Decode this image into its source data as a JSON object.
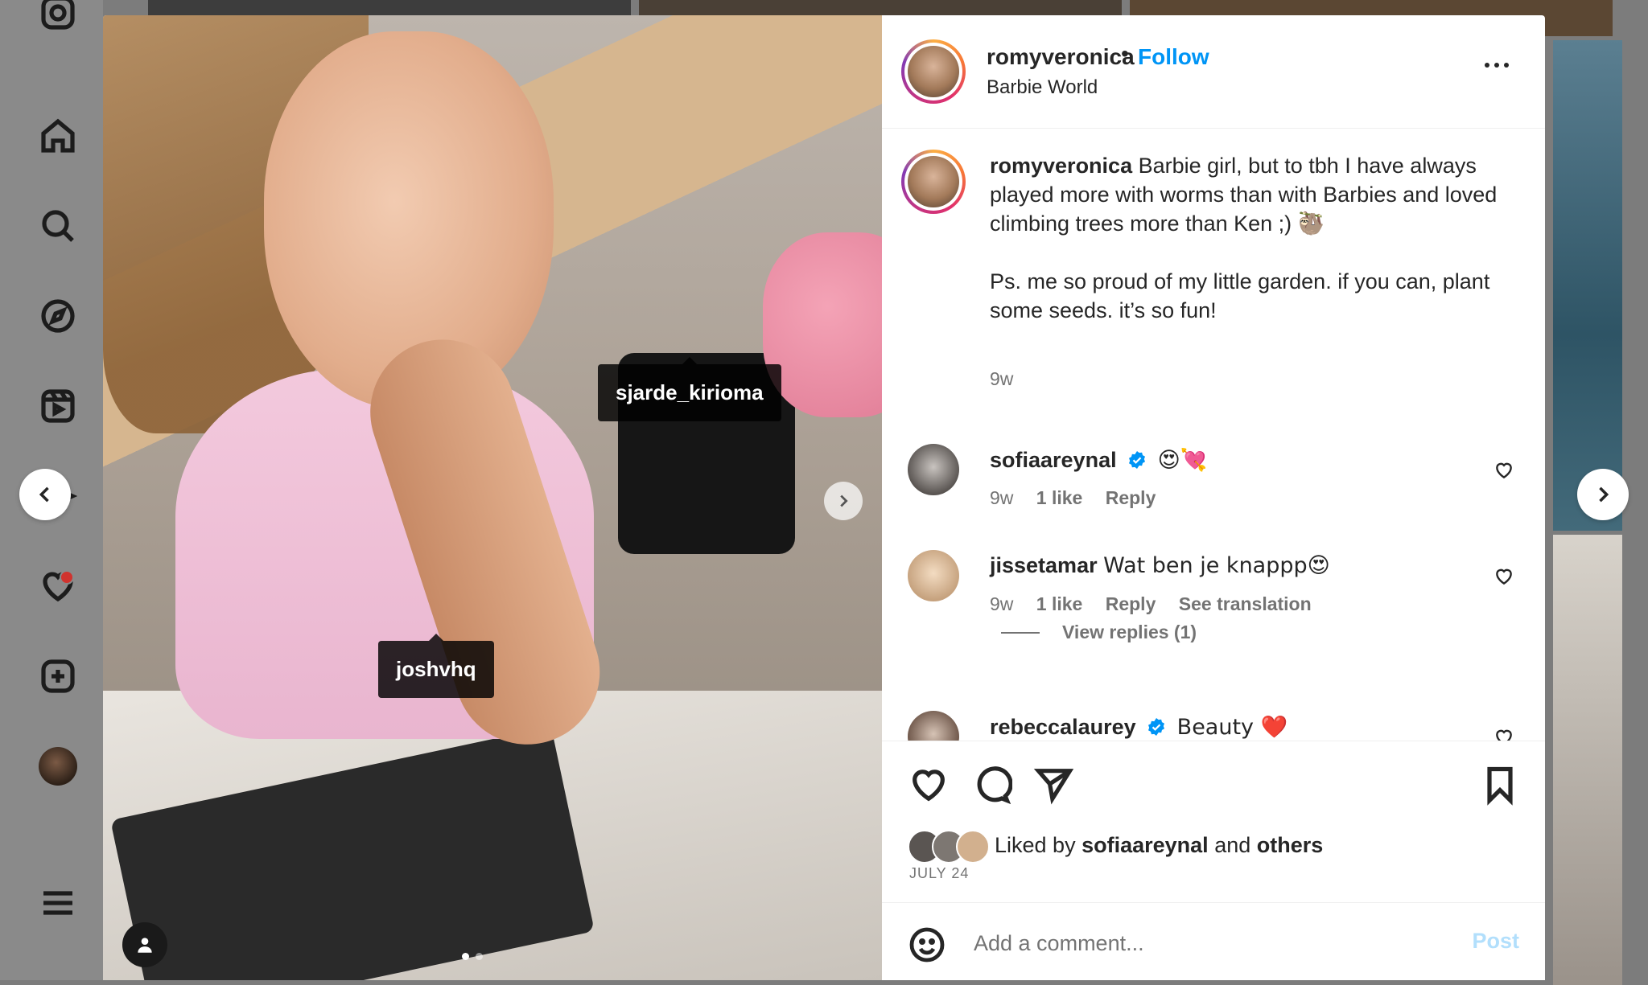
{
  "post": {
    "username": "romyveronica",
    "separator": "•",
    "follow_label": "Follow",
    "location": "Barbie World",
    "tags": [
      "sjarde_kirioma",
      "joshvhq"
    ],
    "caption_user": "romyveronica",
    "caption_text": "Barbie girl, but to tbh I have always played more with worms than with Barbies and loved climbing trees more than Ken ;) 🦥",
    "caption_ps": "Ps. me so proud of my little garden. if you can, plant some seeds. it’s so fun!",
    "caption_time": "9w"
  },
  "comments": [
    {
      "user": "sofiaareynal",
      "verified": true,
      "text": "😍💘",
      "time": "9w",
      "likes": "1 like",
      "reply": "Reply"
    },
    {
      "user": "jissetamar",
      "verified": false,
      "text": "Wat ben je knappp😍",
      "time": "9w",
      "likes": "1 like",
      "reply": "Reply",
      "translate": "See translation"
    },
    {
      "user": "rebeccalaurey",
      "verified": true,
      "text": "Beauty ❤️"
    }
  ],
  "view_replies": "View replies (1)",
  "likes": {
    "prefix": "Liked by",
    "user": "sofiaareynal",
    "and": "and",
    "others": "others",
    "date": "JULY 24"
  },
  "comment_box": {
    "placeholder": "Add a comment...",
    "post_label": "Post"
  },
  "colors": {
    "accent": "#0095f6",
    "post_disabled": "#b2dffc",
    "muted": "#737373"
  }
}
